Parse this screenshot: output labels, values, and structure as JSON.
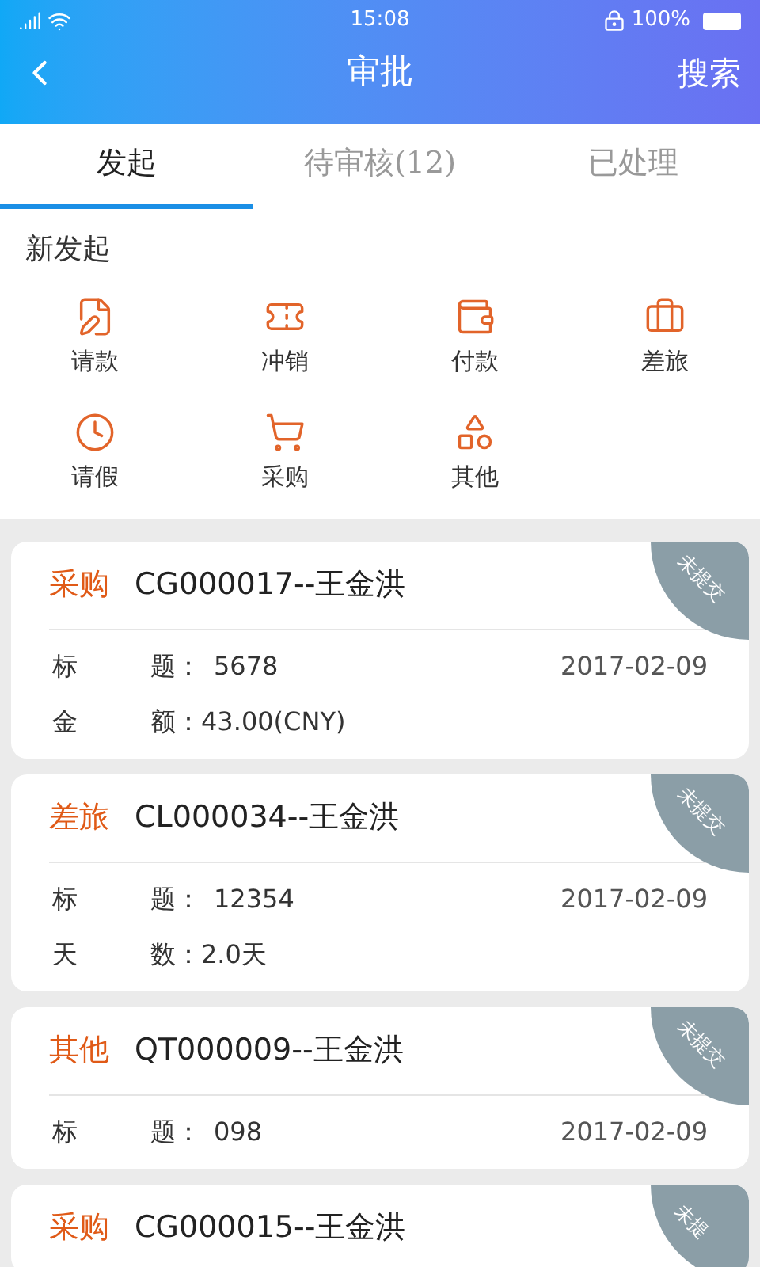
{
  "status_bar": {
    "time": "15:08",
    "battery": "100%"
  },
  "header": {
    "title": "审批",
    "action": "搜索"
  },
  "tabs": [
    {
      "label": "发起",
      "selected": true
    },
    {
      "label": "待审核(12)",
      "selected": false
    },
    {
      "label": "已处理",
      "selected": false
    }
  ],
  "section_title": "新发起",
  "actions": [
    {
      "kind": "request",
      "label": "请款"
    },
    {
      "kind": "offset",
      "label": "冲销"
    },
    {
      "kind": "payment",
      "label": "付款"
    },
    {
      "kind": "travel",
      "label": "差旅"
    },
    {
      "kind": "leave",
      "label": "请假"
    },
    {
      "kind": "purchase",
      "label": "采购"
    },
    {
      "kind": "other",
      "label": "其他"
    }
  ],
  "cards": [
    {
      "type": "采购",
      "title": "CG000017--王金洪",
      "badge": "未提交",
      "date": "2017-02-09",
      "fields": [
        {
          "label": [
            "标",
            "题："
          ],
          "value": "5678"
        },
        {
          "label": [
            "金",
            "额："
          ],
          "value": "43.00(CNY)"
        }
      ]
    },
    {
      "type": "差旅",
      "title": "CL000034--王金洪",
      "badge": "未提交",
      "date": "2017-02-09",
      "fields": [
        {
          "label": [
            "标",
            "题："
          ],
          "value": "12354"
        },
        {
          "label": [
            "天",
            "数："
          ],
          "value": "2.0天"
        }
      ]
    },
    {
      "type": "其他",
      "title": "QT000009--王金洪",
      "badge": "未提交",
      "date": "2017-02-09",
      "fields": [
        {
          "label": [
            "标",
            "题："
          ],
          "value": "098"
        }
      ]
    },
    {
      "type": "采购",
      "title": "CG000015--王金洪",
      "badge": "未提"
    }
  ]
}
